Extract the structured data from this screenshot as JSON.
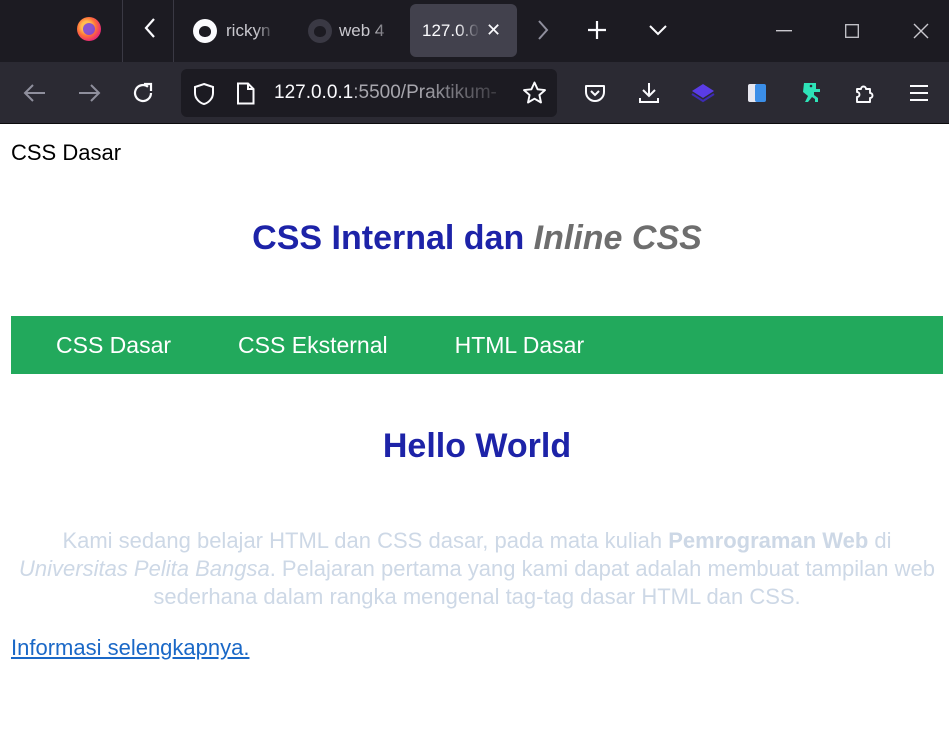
{
  "browser": {
    "tabs": [
      {
        "label": "rickyn",
        "active": false
      },
      {
        "label": "web 4",
        "active": false
      },
      {
        "label": "127.0.0",
        "active": true
      }
    ],
    "close_tab_glyph": "✕",
    "url_host": "127.0.0.1",
    "url_rest": ":5500/Praktikum-",
    "icons": [
      "firefox-logo",
      "list-all-tabs-chevron",
      "github-icon",
      "close-icon",
      "chevron-right-icon",
      "new-tab-icon",
      "chevron-down-icon",
      "minimize-icon",
      "maximize-icon",
      "close-window-icon",
      "back-icon",
      "forward-icon",
      "reload-icon",
      "shield-icon",
      "page-icon",
      "star-icon",
      "pocket-icon",
      "download-icon",
      "extension-icon",
      "puzzle-icon",
      "menu-icon"
    ]
  },
  "page": {
    "doc_title": "CSS Dasar",
    "heading_main": "CSS Internal dan ",
    "heading_em": "Inline CSS",
    "menu": [
      {
        "label": "CSS Dasar"
      },
      {
        "label": "CSS Eksternal"
      },
      {
        "label": "HTML Dasar"
      }
    ],
    "hello": "Hello World",
    "para_1": "Kami sedang belajar HTML dan CSS dasar, pada mata kuliah ",
    "para_bold": "Pemrograman Web",
    "para_2": " di ",
    "para_italic": "Universitas Pelita Bangsa",
    "para_3": ". Pelajaran pertama yang kami dapat adalah membuat tampilan web sederhana dalam rangka mengenal tag-tag dasar HTML dan CSS.",
    "more_link": "Informasi selengkapnya."
  },
  "colors": {
    "heading": "#1d23a8",
    "heading_em": "#6e6e6e",
    "menu_bg": "#22a95c",
    "paragraph": "#cdd8e6",
    "link": "#1a68c7"
  }
}
